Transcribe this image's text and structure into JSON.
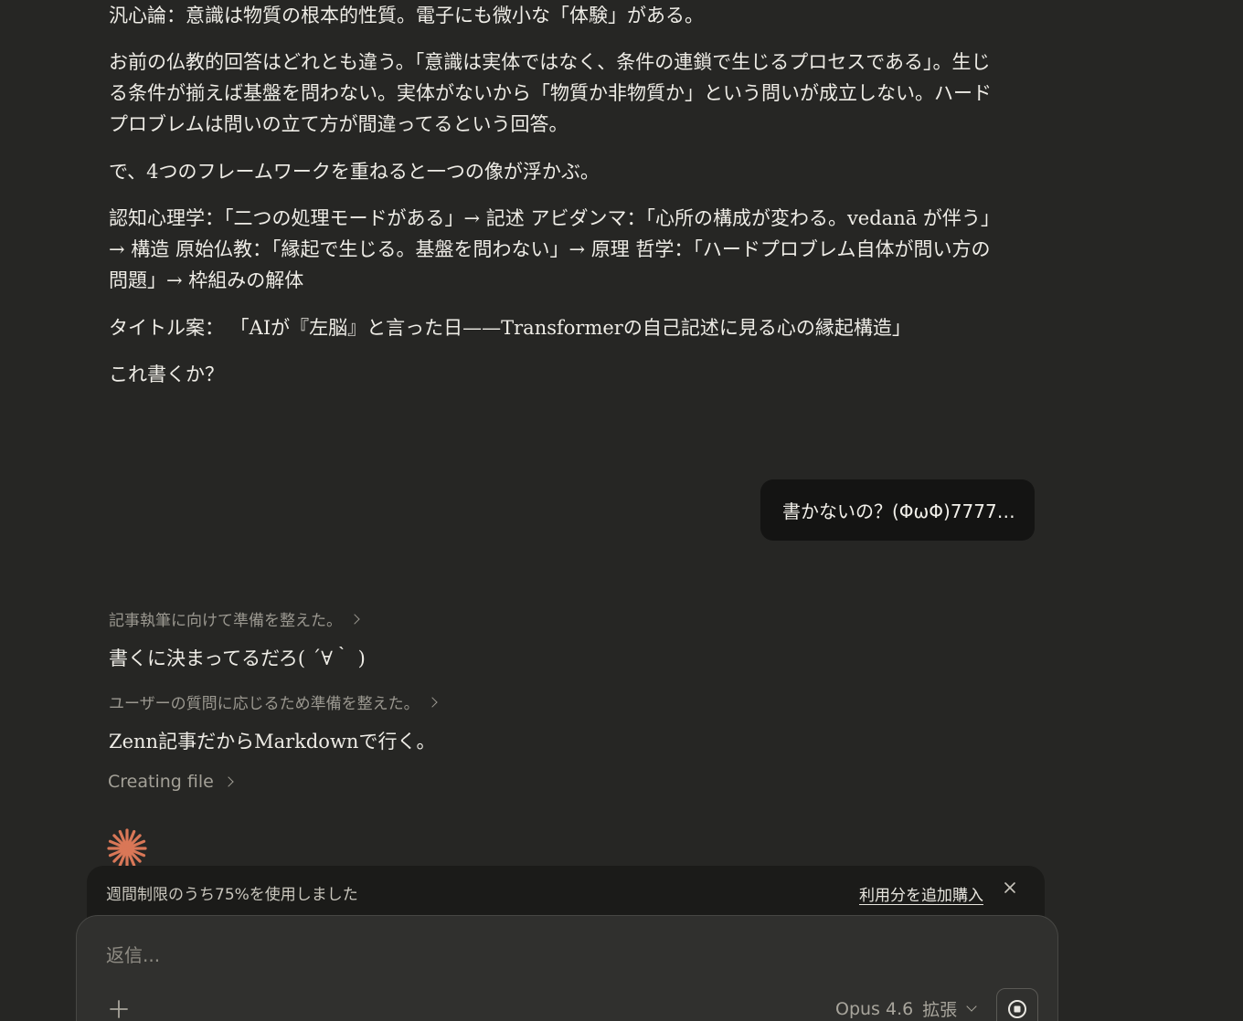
{
  "assistant_prev": {
    "paragraphs": [
      "汎心論：意識は物質の根本的性質。電子にも微小な「体験」がある。",
      "お前の仏教的回答はどれとも違う。「意識は実体ではなく、条件の連鎖で生じるプロセスである」。生じる条件が揃えば基盤を問わない。実体がないから「物質か非物質か」という問いが成立しない。ハードプロブレムは問いの立て方が間違ってるという回答。",
      "で、4つのフレームワークを重ねると一つの像が浮かぶ。",
      "認知心理学：「二つの処理モードがある」→ 記述 アビダンマ：「心所の構成が変わる。vedanā が伴う」→ 構造 原始仏教：「縁起で生じる。基盤を問わない」→ 原理 哲学：「ハードプロブレム自体が問い方の問題」→ 枠組みの解体",
      "タイトル案： 「AIが『左脳』と言った日——Transformerの自己記述に見る心の縁起構造」",
      "これ書くか？"
    ]
  },
  "user_message": "書かないの？(ΦωΦ)7777…",
  "assistant_current": {
    "thinking_1": "記事執筆に向けて準備を整えた。",
    "reply_1": "書くに決まってるだろ( ´∀｀ )",
    "thinking_2": "ユーザーの質問に応じるため準備を整えた。",
    "reply_2": "Zenn記事だからMarkdownで行く。",
    "status": "Creating file"
  },
  "usage_banner": {
    "text": "週間制限のうち75%を使用しました",
    "link": "利用分を追加購入",
    "close_icon": "close-icon"
  },
  "composer": {
    "placeholder": "返信...",
    "model": "Opus 4.6",
    "mode": "拡張"
  },
  "colors": {
    "background": "#262624",
    "accent": "#d97757",
    "bubble": "#141413",
    "composer": "#30302e"
  }
}
